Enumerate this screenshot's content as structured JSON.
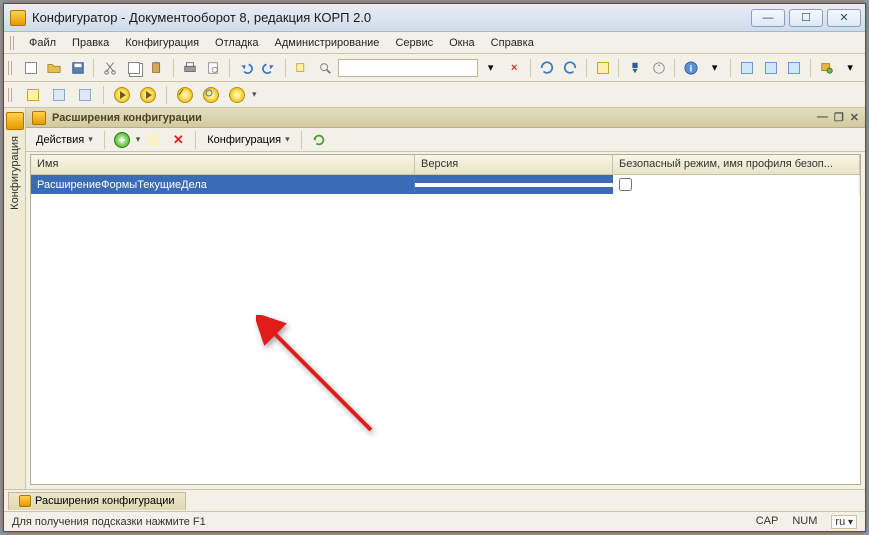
{
  "window": {
    "title": "Конфигуратор - Документооборот 8, редакция КОРП 2.0"
  },
  "menu": {
    "items": [
      "Файл",
      "Правка",
      "Конфигурация",
      "Отладка",
      "Администрирование",
      "Сервис",
      "Окна",
      "Справка"
    ]
  },
  "sidebar": {
    "tab_label": "Конфигурация"
  },
  "panel": {
    "title": "Расширения конфигурации",
    "actions_label": "Действия",
    "config_label": "Конфигурация"
  },
  "grid": {
    "headers": {
      "name": "Имя",
      "version": "Версия",
      "safe": "Безопасный режим, имя профиля безоп..."
    },
    "rows": [
      {
        "name": "РасширениеФормыТекущиеДела",
        "version": "",
        "safe_checked": false
      }
    ]
  },
  "tabs": {
    "tab1": "Расширения конфигурации"
  },
  "status": {
    "hint": "Для получения подсказки нажмите F1",
    "cap": "CAP",
    "num": "NUM",
    "lang": "ru"
  }
}
